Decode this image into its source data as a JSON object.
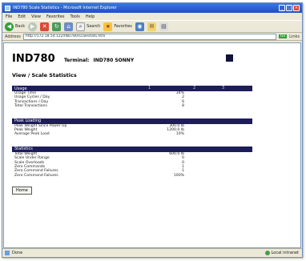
{
  "window": {
    "title": "IND780 Scale Statistics - Microsoft Internet Explorer",
    "menu": [
      "File",
      "Edit",
      "View",
      "Favorites",
      "Tools",
      "Help"
    ],
    "toolbar": {
      "back_label": "Back",
      "search_label": "Search",
      "favorites_label": "Favorites"
    },
    "address": {
      "label": "Address",
      "url": "http://172.18.54.122/IND780/scalestats.htm",
      "go_label": "Go",
      "links_label": "Links"
    }
  },
  "header": {
    "device": "IND780",
    "terminal_label": "Terminal:",
    "terminal_name": "IND780 SONNY"
  },
  "page_title": "View / Scale Statistics",
  "sections": [
    {
      "title": "Usage",
      "markers": [
        "1",
        "2",
        "3"
      ],
      "rows": [
        {
          "label": "Usage Time",
          "value": "34%"
        },
        {
          "label": "Usage Cycles / Day",
          "value": "2"
        },
        {
          "label": "Transactions / Day",
          "value": "6"
        },
        {
          "label": "Total Transactions",
          "value": "8"
        }
      ]
    },
    {
      "title": "Peak Loading",
      "markers": [],
      "rows": [
        {
          "label": "Peak Weight Since Power Up",
          "value": "300.0 lb"
        },
        {
          "label": "Peak Weight",
          "value": "1200.0 lb"
        },
        {
          "label": "Average Peak Load",
          "value": "10%"
        }
      ]
    },
    {
      "title": "Statistics",
      "markers": [],
      "rows": [
        {
          "label": "Total Weight",
          "value": "600.0 lb"
        },
        {
          "label": "Scale Under Range",
          "value": "0"
        },
        {
          "label": "Scale Overloads",
          "value": "0"
        },
        {
          "label": "Zero Commands",
          "value": "1"
        },
        {
          "label": "Zero Command Failures",
          "value": "1"
        },
        {
          "label": "Zero Command Failures",
          "value": "100%"
        }
      ]
    }
  ],
  "home_button": "Home",
  "statusbar": {
    "status": "Done",
    "zone": "Local intranet"
  },
  "colors": {
    "section_header": "#1d1d5a",
    "title_bar": "#1c4fc7"
  }
}
